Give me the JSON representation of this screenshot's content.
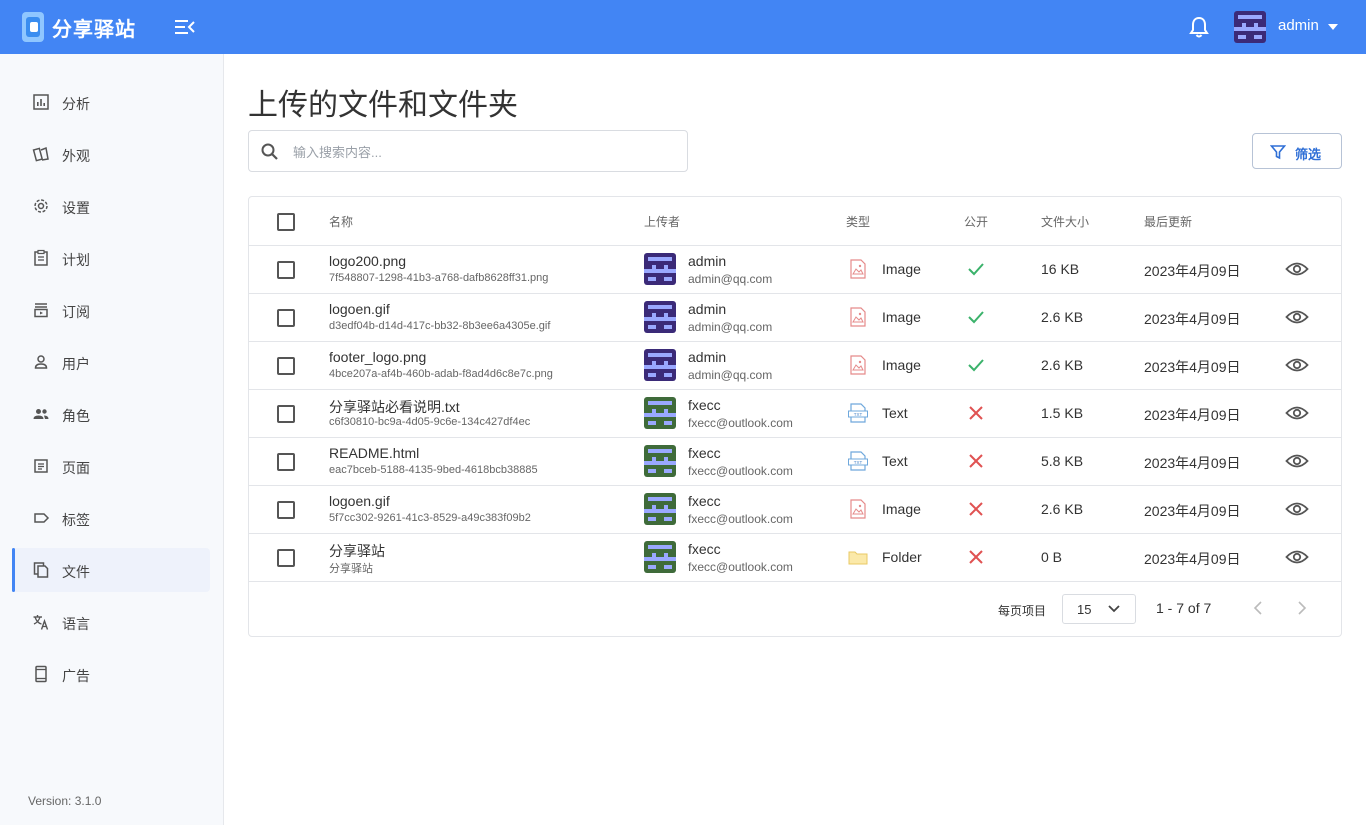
{
  "header": {
    "logo_text": "分享驿站",
    "user_name": "admin"
  },
  "sidebar": {
    "items": [
      {
        "label": "分析",
        "icon": "chart-icon",
        "active": false
      },
      {
        "label": "外观",
        "icon": "palette-icon",
        "active": false
      },
      {
        "label": "设置",
        "icon": "gear-icon",
        "active": false
      },
      {
        "label": "计划",
        "icon": "clipboard-icon",
        "active": false
      },
      {
        "label": "订阅",
        "icon": "subscription-icon",
        "active": false
      },
      {
        "label": "用户",
        "icon": "user-icon",
        "active": false
      },
      {
        "label": "角色",
        "icon": "users-icon",
        "active": false
      },
      {
        "label": "页面",
        "icon": "page-icon",
        "active": false
      },
      {
        "label": "标签",
        "icon": "tag-icon",
        "active": false
      },
      {
        "label": "文件",
        "icon": "files-icon",
        "active": true
      },
      {
        "label": "语言",
        "icon": "translate-icon",
        "active": false
      },
      {
        "label": "广告",
        "icon": "ad-icon",
        "active": false
      }
    ],
    "version": "Version: 3.1.0"
  },
  "main": {
    "title": "上传的文件和文件夹",
    "search": {
      "placeholder": "输入搜索内容..."
    },
    "filter_label": "筛选"
  },
  "table": {
    "columns": [
      "名称",
      "上传者",
      "类型",
      "公开",
      "文件大小",
      "最后更新"
    ],
    "rows": [
      {
        "name": "logo200.png",
        "id": "7f548807-1298-41b3-a768-dafb8628ff31.png",
        "uploader": "admin",
        "email": "admin@qq.com",
        "type": "Image",
        "type_icon": "image-file-icon",
        "public": true,
        "size": "16 KB",
        "updated": "2023年4月09日"
      },
      {
        "name": "logoen.gif",
        "id": "d3edf04b-d14d-417c-bb32-8b3ee6a4305e.gif",
        "uploader": "admin",
        "email": "admin@qq.com",
        "type": "Image",
        "type_icon": "image-file-icon",
        "public": true,
        "size": "2.6 KB",
        "updated": "2023年4月09日"
      },
      {
        "name": "footer_logo.png",
        "id": "4bce207a-af4b-460b-adab-f8ad4d6c8e7c.png",
        "uploader": "admin",
        "email": "admin@qq.com",
        "type": "Image",
        "type_icon": "image-file-icon",
        "public": true,
        "size": "2.6 KB",
        "updated": "2023年4月09日"
      },
      {
        "name": "分享驿站必看说明.txt",
        "id": "c6f30810-bc9a-4d05-9c6e-134c427df4ec",
        "uploader": "fxecc",
        "email": "fxecc@outlook.com",
        "type": "Text",
        "type_icon": "text-file-icon",
        "public": false,
        "size": "1.5 KB",
        "updated": "2023年4月09日"
      },
      {
        "name": "README.html",
        "id": "eac7bceb-5188-4135-9bed-4618bcb38885",
        "uploader": "fxecc",
        "email": "fxecc@outlook.com",
        "type": "Text",
        "type_icon": "text-file-icon",
        "public": false,
        "size": "5.8 KB",
        "updated": "2023年4月09日"
      },
      {
        "name": "logoen.gif",
        "id": "5f7cc302-9261-41c3-8529-a49c383f09b2",
        "uploader": "fxecc",
        "email": "fxecc@outlook.com",
        "type": "Image",
        "type_icon": "image-file-icon",
        "public": false,
        "size": "2.6 KB",
        "updated": "2023年4月09日"
      },
      {
        "name": "分享驿站",
        "id": "分享驿站",
        "uploader": "fxecc",
        "email": "fxecc@outlook.com",
        "type": "Folder",
        "type_icon": "folder-icon",
        "public": false,
        "size": "0 B",
        "updated": "2023年4月09日"
      }
    ]
  },
  "pagination": {
    "per_page_label": "每页项目",
    "per_page_value": "15",
    "range": "1 - 7 of 7"
  },
  "colors": {
    "header_bg": "#4285f4",
    "public_yes": "#3bb26b",
    "public_no": "#e05252",
    "admin_avatar": "#3b2a78",
    "fxecc_avatar": "#3f6b3a"
  }
}
